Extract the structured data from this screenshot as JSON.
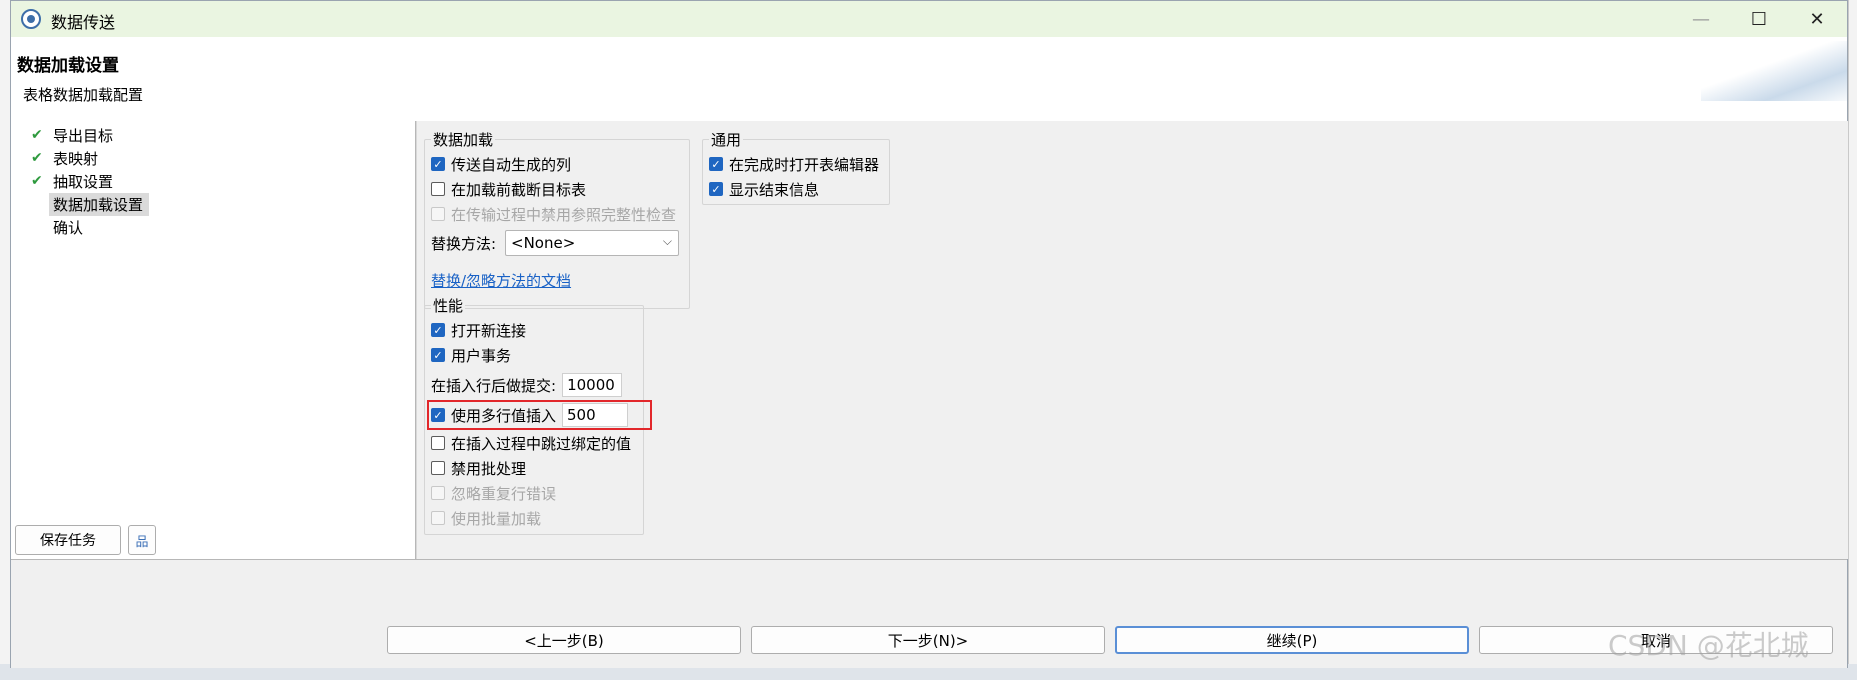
{
  "window": {
    "title": "数据传送",
    "controls": {
      "minimize": "—",
      "maximize": "☐",
      "close": "✕"
    }
  },
  "header": {
    "title": "数据加载设置",
    "subtitle": "表格数据加载配置"
  },
  "nav": {
    "items": [
      {
        "label": "导出目标",
        "done": true,
        "selected": false
      },
      {
        "label": "表映射",
        "done": true,
        "selected": false
      },
      {
        "label": "抽取设置",
        "done": true,
        "selected": false
      },
      {
        "label": "数据加载设置",
        "done": false,
        "selected": true
      },
      {
        "label": "确认",
        "done": false,
        "selected": false
      }
    ],
    "save_task": "保存任务",
    "check_glyph": "✔",
    "tree_glyph": "品"
  },
  "data_loading": {
    "legend": "数据加载",
    "transfer_auto_columns": {
      "label": "传送自动生成的列",
      "checked": true
    },
    "truncate_before_load": {
      "label": "在加载前截断目标表",
      "checked": false
    },
    "disable_ref_integrity": {
      "label": "在传输过程中禁用参照完整性检查",
      "checked": false,
      "disabled": true
    },
    "replace_method_label": "替换方法:",
    "replace_method_value": "<None>",
    "replace_doc_link": "替换/忽略方法的文档"
  },
  "general": {
    "legend": "通用",
    "open_editor_on_finish": {
      "label": "在完成时打开表编辑器",
      "checked": true
    },
    "show_finish_message": {
      "label": "显示结束信息",
      "checked": true
    }
  },
  "performance": {
    "legend": "性能",
    "open_new_connection": {
      "label": "打开新连接",
      "checked": true
    },
    "user_transaction": {
      "label": "用户事务",
      "checked": true
    },
    "commit_after_rows_label": "在插入行后做提交:",
    "commit_after_rows_value": "10000",
    "multi_row_insert": {
      "label": "使用多行值插入",
      "checked": true,
      "value": "500"
    },
    "skip_bound_values": {
      "label": "在插入过程中跳过绑定的值",
      "checked": false
    },
    "disable_batch": {
      "label": "禁用批处理",
      "checked": false
    },
    "ignore_duplicate_errors": {
      "label": "忽略重复行错误",
      "checked": false,
      "disabled": true
    },
    "use_bulk_load": {
      "label": "使用批量加载",
      "checked": false,
      "disabled": true
    }
  },
  "footer": {
    "prev": "<上一步(B)",
    "next": "下一步(N)>",
    "continue": "继续(P)",
    "cancel": "取消"
  },
  "watermark": "CSDN @花北城",
  "colors": {
    "title_bar": "#eaf5e1",
    "checkbox_checked": "#1f66c1",
    "highlight_box": "#e2272b",
    "link": "#1a62c6",
    "done_check": "#2e9a3e"
  }
}
